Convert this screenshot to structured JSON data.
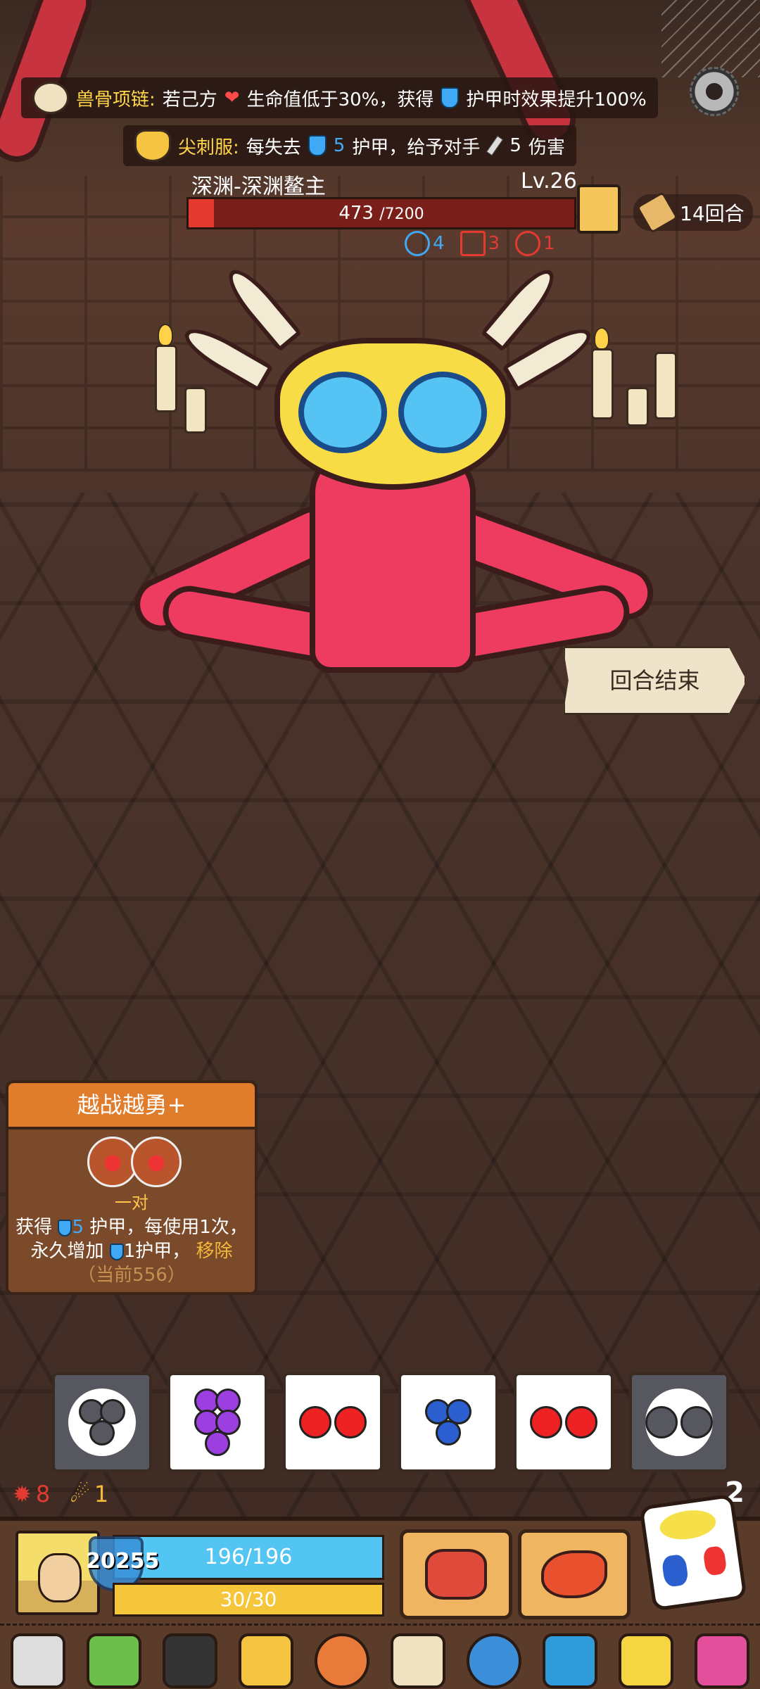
{
  "top_effects": [
    {
      "icon": "bone-necklace-icon",
      "name": "兽骨项链:",
      "text_a": "若己方",
      "text_b": "生命值低于30%，获得",
      "text_c": "护甲时效果提升100%"
    },
    {
      "icon": "spike-armor-icon",
      "name": "尖刺服:",
      "text_a": "每失去",
      "armor": "5",
      "text_b": "护甲，给予对手",
      "damage": "5",
      "text_c": "伤害"
    }
  ],
  "boss": {
    "name": "深渊-深渊鳌主",
    "level": "Lv.26",
    "hp_current": "473",
    "hp_max": "/7200",
    "hp_fraction": 0.066,
    "statuses": [
      {
        "icon": "vortex-icon",
        "value": "4",
        "color": "#3fa9f5"
      },
      {
        "icon": "bleed-icon",
        "value": "3",
        "color": "#e33b30"
      },
      {
        "icon": "curse-icon",
        "value": "1",
        "color": "#e33b30"
      }
    ]
  },
  "turn_counter": "14回合",
  "end_turn_label": "回合结束",
  "skill_card": {
    "title": "越战越勇+",
    "pattern_label": "一对",
    "desc_a": "获得",
    "armor_gain": "5",
    "desc_b": "护甲，每使用1次，永久增加",
    "armor_perm": "1",
    "desc_c": "护甲，",
    "remove": "移除",
    "current": "（当前556）"
  },
  "dice": [
    {
      "type": "blueberry",
      "locked": true,
      "color": "#56575f"
    },
    {
      "type": "grape",
      "locked": false,
      "color": "#9b3fe0"
    },
    {
      "type": "cherry",
      "locked": false,
      "color": "#e22"
    },
    {
      "type": "blueberry",
      "locked": false,
      "color": "#2b5fd0"
    },
    {
      "type": "cherry",
      "locked": false,
      "color": "#e22"
    },
    {
      "type": "cherry",
      "locked": true,
      "color": "#56575f"
    }
  ],
  "counters": [
    {
      "icon": "burst-icon",
      "value": "8",
      "color": "#e33b30"
    },
    {
      "icon": "claw-icon",
      "value": "1",
      "color": "#f5b93a"
    }
  ],
  "reroll_count": "2",
  "player": {
    "armor": "20255",
    "hp": "196/196",
    "energy": "30/30"
  },
  "relics": [
    "crossed-swords-icon",
    "green-potion-icon",
    "collar-icon",
    "spike-mask-icon",
    "meat-icon",
    "spike-ball-icon",
    "blue-shell-icon",
    "blue-pumpkin-icon",
    "golden-helmet-icon",
    "pink-totem-icon"
  ],
  "colors": {
    "hp_bar": "#52c5f2",
    "energy_bar": "#f5c53a",
    "boss_hp": "#e33b30",
    "card_header": "#e07d2d"
  }
}
